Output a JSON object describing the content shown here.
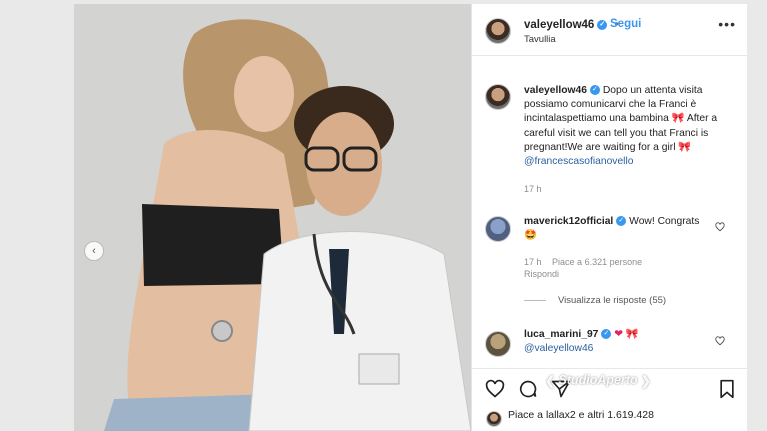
{
  "header": {
    "username": "valeyellow46",
    "follow_label": "Segui",
    "location": "Tavullia",
    "more_icon": "more-icon"
  },
  "caption": {
    "username": "valeyellow46",
    "text_it": "Dopo un attenta visita possiamo comunicarvi che la Franci è incintalaspettiamo una bambina",
    "text_en": "After a careful visit we can tell you that Franci is pregnant!We are waiting for a girl",
    "mention": "@francescasofianovello",
    "time": "17 h"
  },
  "comments": [
    {
      "username": "maverick12official",
      "text": "Wow! Congrats",
      "time": "17 h",
      "likes": "Piace a 6.321 persone",
      "reply_label": "Rispondi",
      "view_replies": "Visualizza le risposte (55)"
    },
    {
      "username": "luca_marini_97",
      "mention": "@valeyellow46"
    }
  ],
  "footer": {
    "likes_text": "Piace a lallax2 e altri 1.619.428"
  },
  "watermark": "StudioAperto",
  "colors": {
    "accent": "#3897f0",
    "heart": "#e0245e"
  }
}
